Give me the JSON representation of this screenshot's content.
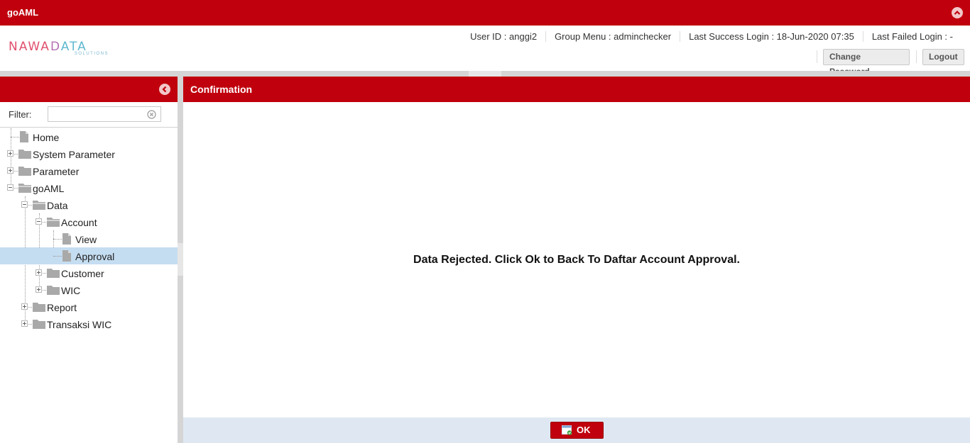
{
  "app": {
    "title": "goAML"
  },
  "logo": {
    "main_a": "NAWA",
    "main_b": "D",
    "main_c": "ATA",
    "sub": "SOLUTIONS"
  },
  "user_info": {
    "user_id": "User ID : anggi2",
    "group_menu": "Group Menu : adminchecker",
    "last_success": "Last Success Login : 18-Jun-2020 07:35",
    "last_failed": "Last Failed Login : -"
  },
  "header_buttons": {
    "change_password": "Change Password",
    "logout": "Logout"
  },
  "sidebar": {
    "filter_label": "Filter:",
    "filter_value": "",
    "tree": [
      {
        "label": "Home",
        "type": "leaf"
      },
      {
        "label": "System Parameter",
        "type": "folder",
        "expanded": false
      },
      {
        "label": "Parameter",
        "type": "folder",
        "expanded": false
      },
      {
        "label": "goAML",
        "type": "folder",
        "expanded": true
      },
      {
        "label": "Data",
        "type": "folder",
        "expanded": true
      },
      {
        "label": "Account",
        "type": "folder",
        "expanded": true
      },
      {
        "label": "View",
        "type": "leaf"
      },
      {
        "label": "Approval",
        "type": "leaf",
        "selected": true
      },
      {
        "label": "Customer",
        "type": "folder",
        "expanded": false
      },
      {
        "label": "WIC",
        "type": "folder",
        "expanded": false
      },
      {
        "label": "Report",
        "type": "folder",
        "expanded": false
      },
      {
        "label": "Transaksi WIC",
        "type": "folder",
        "expanded": false
      }
    ]
  },
  "main": {
    "panel_title": "Confirmation",
    "message": "Data Rejected. Click Ok to Back To Daftar Account Approval.",
    "ok_label": "OK"
  },
  "colors": {
    "brand_red": "#c0000d",
    "selected_row": "#c5ddf1",
    "footer_bg": "#dfe8f2"
  },
  "icons": {
    "collapse": "chevron-up-circle-icon",
    "side_collapse": "chevron-left-circle-icon",
    "clear": "clear-circle-icon",
    "folder": "folder-icon",
    "page": "page-icon",
    "ok": "ok-window-icon"
  }
}
